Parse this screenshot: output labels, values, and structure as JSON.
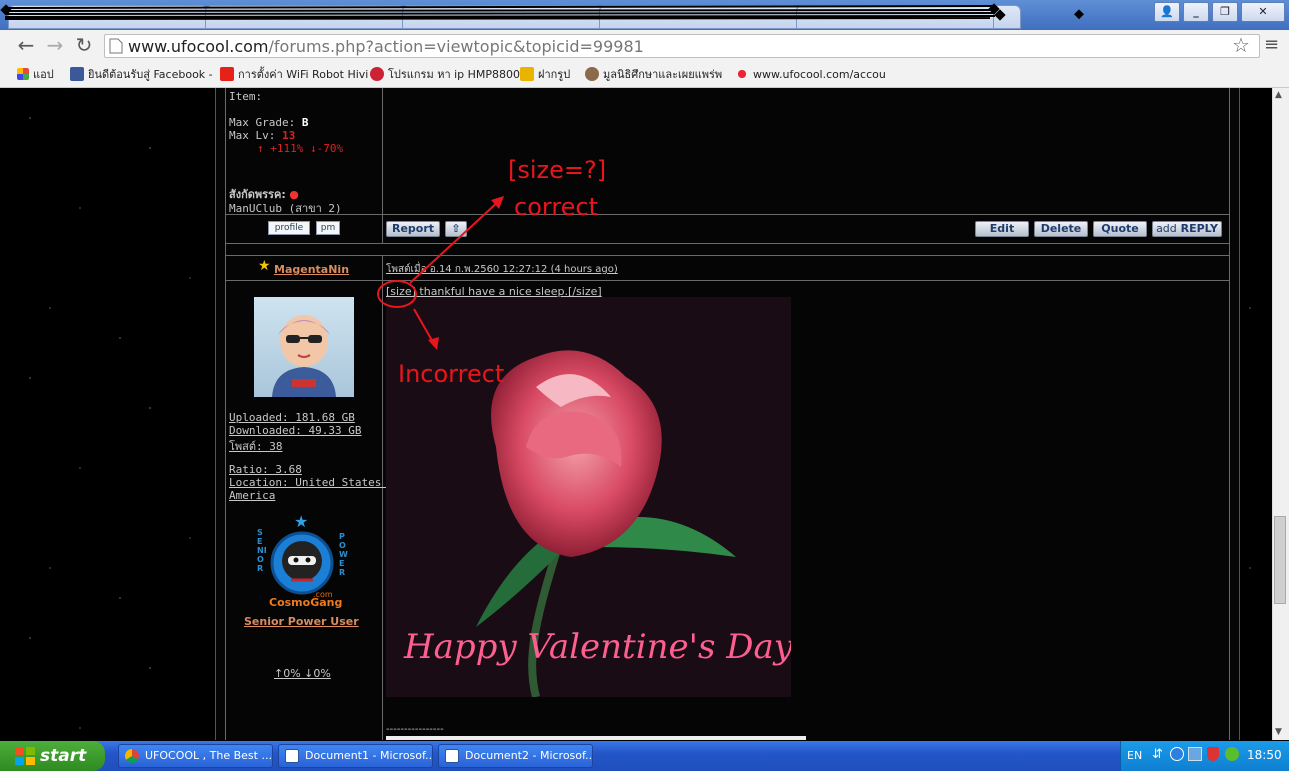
{
  "browser": {
    "address_url": "www.ufocool.com",
    "address_url_rest": "/forums.php?action=viewtopic&topicid=99981",
    "bookmarks": [
      "แอป",
      "ยินดีต้อนรับสู่ Facebook -",
      "การตั้งค่า WiFi Robot Hivi",
      "โปรแกรม หา ip HMP8800",
      "ฝากรูป",
      "มูลนิธิศึกษาและเผยแพร่พ",
      "www.ufocool.com/accou"
    ],
    "window_controls": [
      "_",
      "❐",
      "✕"
    ]
  },
  "post1": {
    "item_label": "Item:",
    "max_grade_label": "Max Grade:",
    "max_grade_value": "B",
    "max_lv_label": "Max Lv:",
    "max_lv_value": "13",
    "rate_up": "↑ +111%",
    "rate_down": "↓-70%",
    "affiliation_label": "สังกัดพรรค:",
    "affiliation_value": "ManUClub (สาขา 2)",
    "btn_profile": "profile",
    "btn_pm": "pm",
    "btn_report": "Report",
    "btn_top": "⇧",
    "btn_edit": "Edit",
    "btn_delete": "Delete",
    "btn_quote": "Quote",
    "btn_add": "add",
    "btn_reply": "REPLY"
  },
  "post2": {
    "username": "MagentaNin",
    "posted_at": "โพสต์เมื่อ อ.14 ก.พ.2560 12:27:12 (4 hours ago)",
    "body_text": "[size] thankful have a nice sleep.[/size]",
    "uploaded": "Uploaded: 181.68 GB",
    "downloaded": "Downloaded: 49.33 GB",
    "posts": "โพสต์: 38",
    "ratio": "Ratio: 3.68",
    "location_line1": "Location: United States of",
    "location_line2": "America",
    "rank_title": "Senior Power User",
    "rank_badge_left": "SENIOR",
    "rank_badge_right": "POWER",
    "rank_badge_name": "CosmoGang",
    "rank_badge_com": ".com",
    "rate_line": "↑0% ↓0%",
    "image_caption": "Happy Valentine's Day",
    "separator": "----------------"
  },
  "annotations": {
    "correct_line1": "[size=?]",
    "correct_line2": "correct",
    "incorrect": "Incorrect",
    "color": "#e8161c"
  },
  "taskbar": {
    "start_label": "start",
    "tasks": [
      "UFOCOOL , The Best ...",
      "Document1 - Microsof...",
      "Document2 - Microsof..."
    ],
    "lang": "EN",
    "clock": "18:50"
  }
}
